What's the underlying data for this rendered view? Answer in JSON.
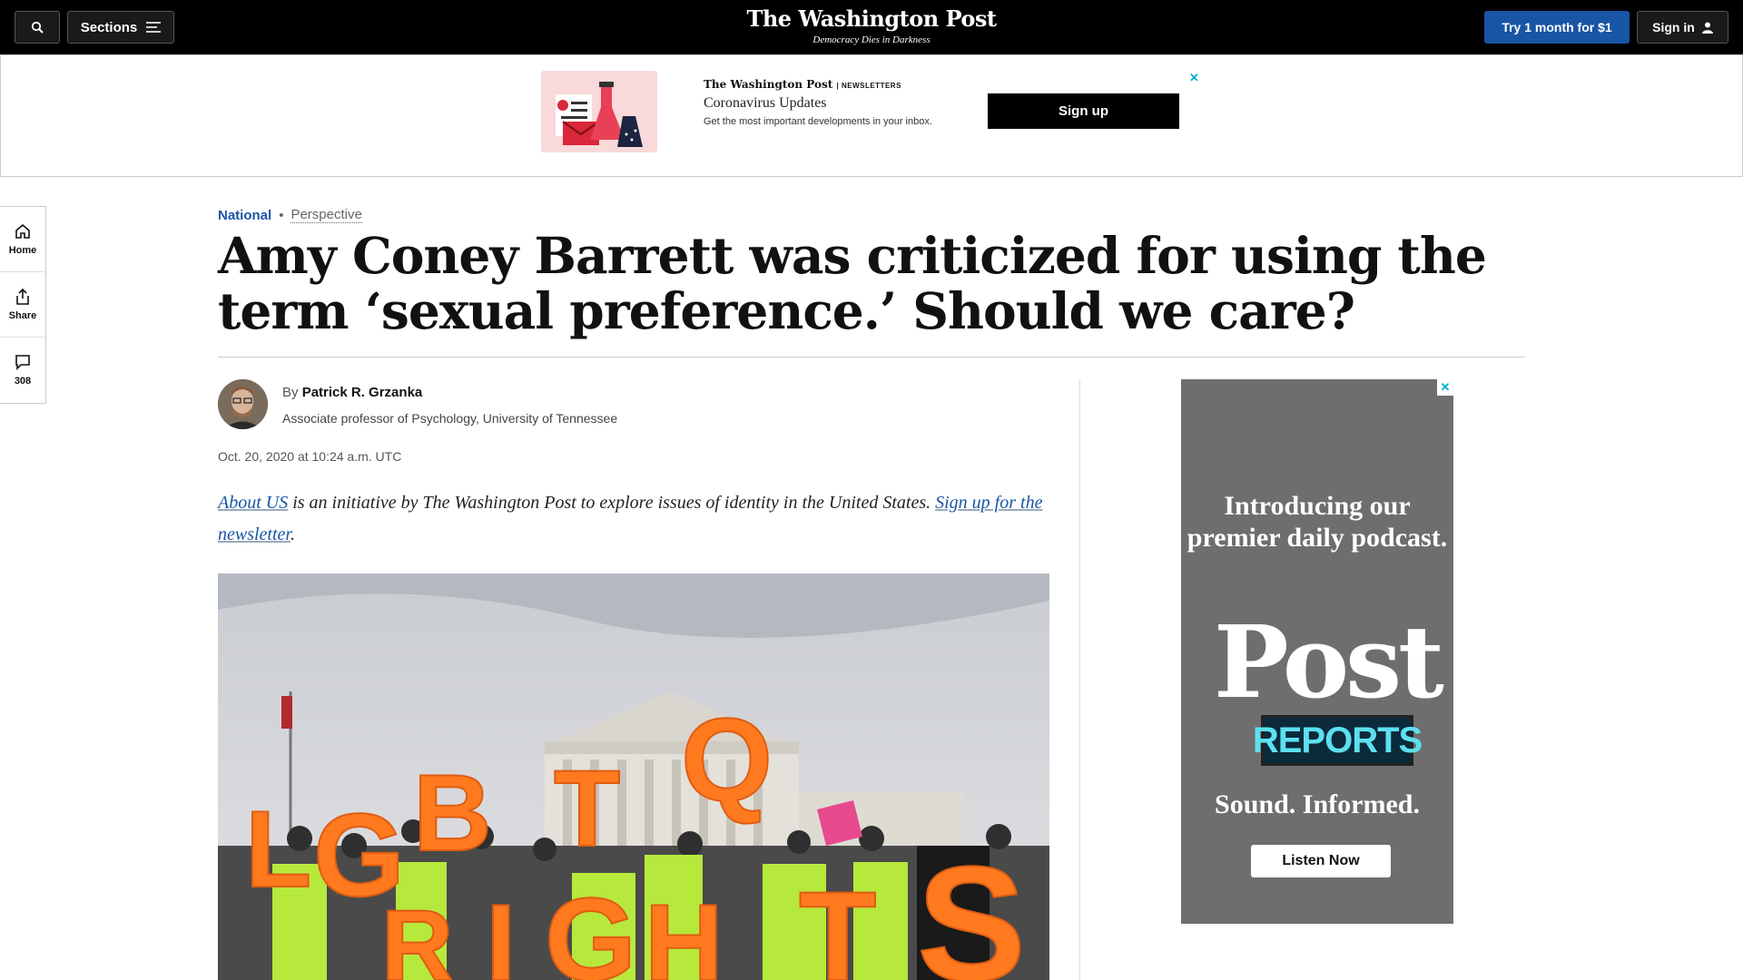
{
  "topbar": {
    "sections_label": "Sections",
    "logo": "The Washington Post",
    "tagline": "Democracy Dies in Darkness",
    "try_label": "Try 1 month for $1",
    "signin_label": "Sign in"
  },
  "newsletter_ad": {
    "brand": "The Washington Post",
    "brand_suffix": "NEWSLETTERS",
    "title": "Coronavirus Updates",
    "description": "Get the most important developments in your inbox.",
    "cta": "Sign up",
    "close": "✕"
  },
  "rail": {
    "home": "Home",
    "share": "Share",
    "comments": "308"
  },
  "article": {
    "section": "National",
    "label": "Perspective",
    "headline": "Amy Coney Barrett was criticized for using the term ‘sexual preference.’ Should we care?",
    "by": "By",
    "author": "Patrick R. Grzanka",
    "author_bio": "Associate professor of Psychology, University of Tennessee",
    "date": "Oct. 20, 2020 at 10:24 a.m. UTC",
    "intro_link1": "About US",
    "intro_text": " is an initiative by The Washington Post to explore issues of identity in the United States. ",
    "intro_link2": "Sign up for the newsletter",
    "intro_end": "."
  },
  "podcast_ad": {
    "intro": "Introducing our premier daily podcast.",
    "logo": "Post",
    "reports": "REPORTS",
    "tagline": "Sound. Informed.",
    "cta": "Listen Now",
    "close": "✕"
  },
  "colors": {
    "accent_blue": "#1955a5",
    "topbar_bg": "#000000",
    "ad_bg": "#6e6e6e"
  }
}
